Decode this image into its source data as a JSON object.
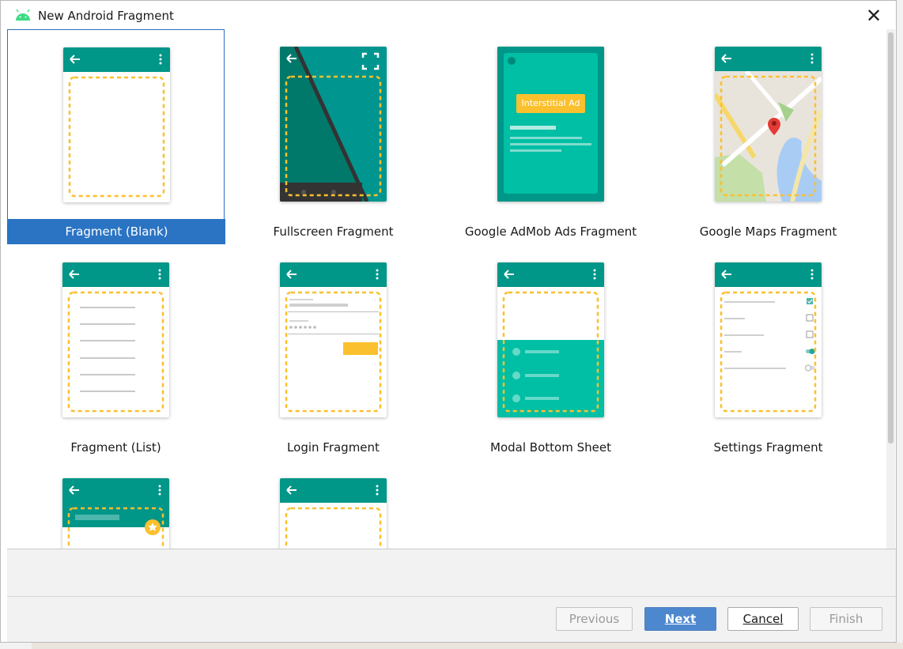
{
  "window": {
    "title": "New Android Fragment",
    "close_symbol": "✕",
    "icon": "android-icon"
  },
  "templates": [
    {
      "label": "Fragment (Blank)",
      "selected": true,
      "icon": "blank-fragment-preview"
    },
    {
      "label": "Fullscreen Fragment",
      "selected": false,
      "icon": "fullscreen-fragment-preview"
    },
    {
      "label": "Google AdMob Ads Fragment",
      "selected": false,
      "icon": "admob-fragment-preview",
      "badge": "Interstitial Ad"
    },
    {
      "label": "Google Maps Fragment",
      "selected": false,
      "icon": "maps-fragment-preview"
    },
    {
      "label": "Fragment (List)",
      "selected": false,
      "icon": "list-fragment-preview"
    },
    {
      "label": "Login Fragment",
      "selected": false,
      "icon": "login-fragment-preview"
    },
    {
      "label": "Modal Bottom Sheet",
      "selected": false,
      "icon": "bottom-sheet-preview"
    },
    {
      "label": "Settings Fragment",
      "selected": false,
      "icon": "settings-fragment-preview"
    },
    {
      "label": "",
      "selected": false,
      "icon": "scrolling-fragment-preview"
    },
    {
      "label": "",
      "selected": false,
      "icon": "fragment-viewmodel-preview"
    }
  ],
  "buttons": {
    "previous": "Previous",
    "next": "Next",
    "cancel": "Cancel",
    "finish": "Finish"
  },
  "colors": {
    "toolbar_teal": "#009688",
    "accent_yellow": "#FBC02D",
    "selection_blue": "#2B74C4",
    "next_button": "#4D88CF"
  }
}
